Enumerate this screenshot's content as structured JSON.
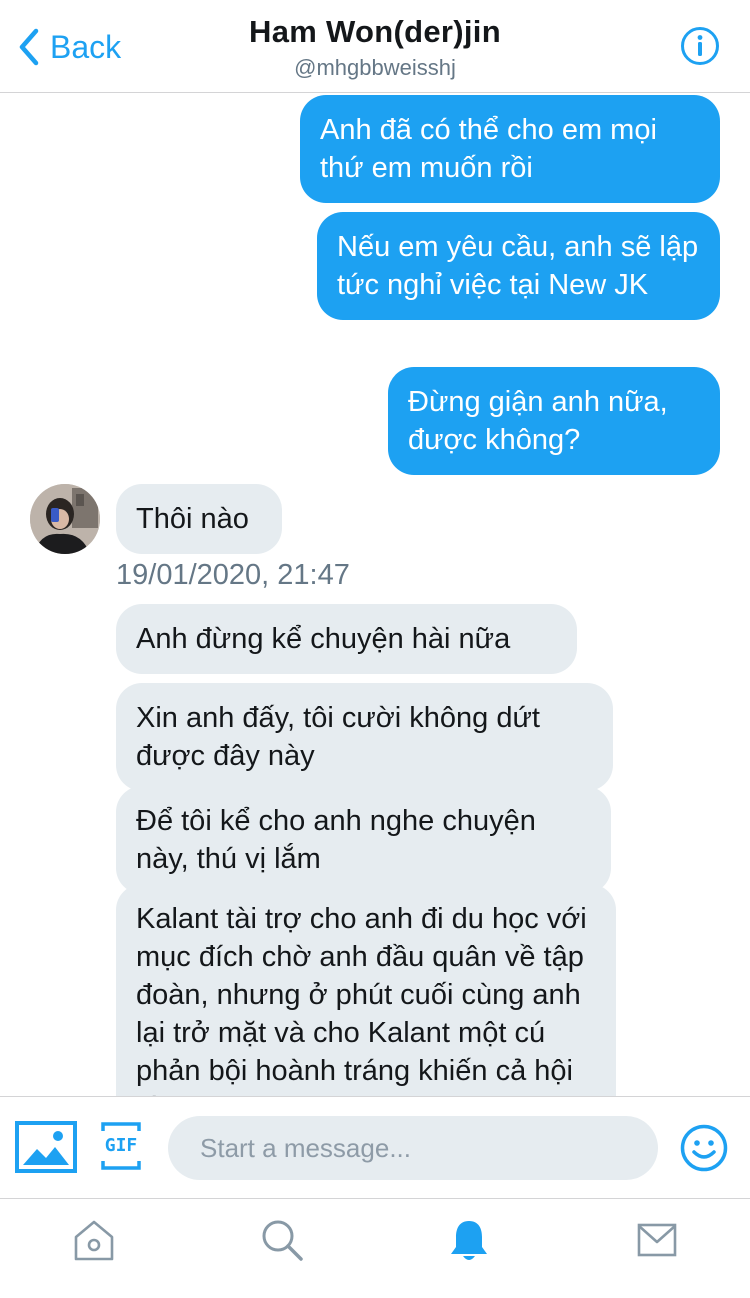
{
  "header": {
    "back_label": "Back",
    "title": "Ham Won(der)jin",
    "handle": "@mhgbbweisshj"
  },
  "messages": {
    "outgoing": [
      "Anh đã có thể cho em mọi thứ em muốn rồi",
      "Nếu em yêu cầu, anh sẽ lập tức nghỉ việc tại New JK",
      "Đừng giận anh nữa, được không?"
    ],
    "first_incoming": "Thôi nào",
    "timestamp": "19/01/2020, 21:47",
    "incoming": [
      "Anh đừng kể chuyện hài nữa",
      "Xin anh đấy, tôi cười không dứt được đây này",
      "Để tôi kể cho anh nghe chuyện này, thú vị lắm",
      "Kalant tài trợ cho anh đi du học với mục đích chờ anh đầu quân về tập đoàn, nhưng ở phút cuối cùng anh lại trở mặt và cho Kalant một cú phản bội hoành tráng khiến cả hội đồng không ngờ"
    ]
  },
  "composer": {
    "placeholder": "Start a message...",
    "gif_label": "GIF"
  },
  "colors": {
    "accent": "#1da1f2",
    "incoming_bubble": "#e6ecf0",
    "secondary_text": "#657786"
  },
  "tabbar": {
    "items": [
      "home-icon",
      "search-icon",
      "bell-icon",
      "mail-icon"
    ],
    "active": "bell-icon"
  }
}
